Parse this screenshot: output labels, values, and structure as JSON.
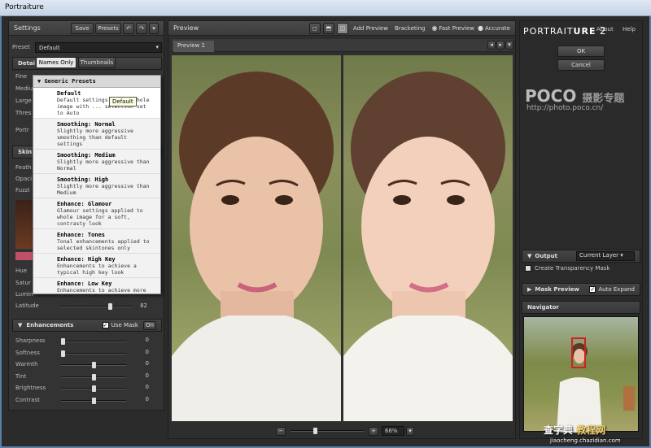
{
  "window": {
    "title": "Portraiture"
  },
  "settings": {
    "title": "Settings",
    "save": "Save",
    "presets": "Presets",
    "preset_label": "Preset",
    "preset_value": "Default",
    "details_title": "Detai",
    "detail_rows": [
      "Fine",
      "Mediu",
      "Large",
      "Thres"
    ],
    "portrait_row": "Portr",
    "skin_title": "Skin",
    "skin_rows": [
      "Feath",
      "Opaci",
      "Fuzzi"
    ],
    "hue": "Hue",
    "saturation": "Satur",
    "luminance": "Lumin",
    "latitude": "Latitude",
    "latitude_value": "82"
  },
  "enhancements": {
    "title": "Enhancements",
    "use_mask": "Use Mask",
    "on": "On",
    "sliders": [
      {
        "label": "Sharpness",
        "value": "0"
      },
      {
        "label": "Softness",
        "value": "0"
      },
      {
        "label": "Warmth",
        "value": "0"
      },
      {
        "label": "Tint",
        "value": "0"
      },
      {
        "label": "Brightness",
        "value": "0"
      },
      {
        "label": "Contrast",
        "value": "0"
      }
    ]
  },
  "preset_menu": {
    "tab_names": "Names Only",
    "tab_thumbs": "Thumbnails",
    "group": "Generic Presets",
    "tooltip": "Default",
    "items": [
      {
        "name": "Default",
        "desc": "Default settings ... to whole image with ... selection set to Auto"
      },
      {
        "name": "Smoothing: Normal",
        "desc": "Slightly more aggressive smoothing than default settings"
      },
      {
        "name": "Smoothing: Medium",
        "desc": "Slightly more aggressive than Normal"
      },
      {
        "name": "Smoothing: High",
        "desc": "Slightly more aggressive than Medium"
      },
      {
        "name": "Enhance: Glamour",
        "desc": "Glamour settings applied to whole image for a soft, contrasty look"
      },
      {
        "name": "Enhance: Tones",
        "desc": "Tonal enhancements applied to selected skintones only"
      },
      {
        "name": "Enhance: High Key",
        "desc": "Enhancements to achieve a typical high key look"
      },
      {
        "name": "Enhance: Low Key",
        "desc": "Enhancements to achieve more of a typical low key look"
      }
    ]
  },
  "preview": {
    "title": "Preview",
    "add_preview": "Add Preview",
    "bracketing": "Bracketing",
    "fast_preview": "Fast Preview",
    "accurate": "Accurate",
    "tab": "Preview 1",
    "zoom": "66%"
  },
  "right": {
    "logo_a": "PORTRAIT",
    "logo_b": "URE",
    "logo_ver": "2",
    "about": "About",
    "help": "Help",
    "ok": "OK",
    "cancel": "Cancel",
    "watermark_brand": "POCO",
    "watermark_cn": "摄影专题",
    "watermark_url": "http://photo.poco.cn/",
    "output": "Output",
    "output_value": "Current Layer",
    "transparency": "Create Transparency Mask",
    "mask_preview": "Mask Preview",
    "auto_expand": "Auto Expand",
    "navigator": "Navigator"
  },
  "footer_watermark": {
    "cn": "查字典",
    "cn2": "教程网",
    "url": "jiaocheng.chazidian.com"
  },
  "colors": {
    "accent": "#5a7ea8",
    "panel": "#333333",
    "highlight": "#c0506a"
  }
}
